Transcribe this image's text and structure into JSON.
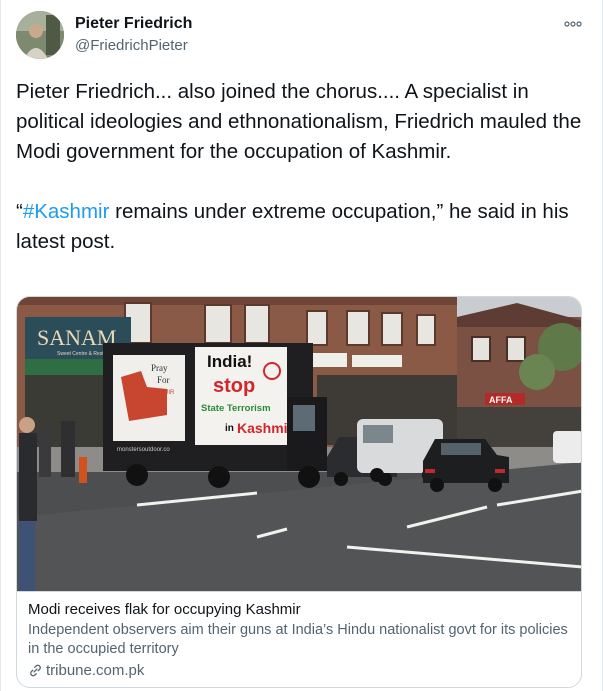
{
  "user": {
    "display_name": "Pieter Friedrich",
    "handle": "@FriedrichPieter"
  },
  "tweet": {
    "paragraph1": "Pieter Friedrich... also joined the chorus.... A specialist in political ideologies and ethnonationalism, Friedrich mauled the Modi government for the occupation of Kashmir.",
    "quote_open": "“",
    "hashtag": "#Kashmir",
    "paragraph2_rest": " remains under extreme occupation,” he said in his latest post."
  },
  "card": {
    "title": "Modi receives flak for occupying Kashmir",
    "description": "Independent observers aim their guns at India’s Hindu nationalist govt for its policies in the occupied territory",
    "domain": "tribune.com.pk",
    "image": {
      "shop_sign": "SANAM",
      "shop_subsign": "Sweet Centre & Restaurant",
      "panel_left_text": [
        "Pray",
        "For",
        "KASHMIR"
      ],
      "panel_right_text": [
        "India!",
        "stop",
        "State Terrorism",
        "in",
        "Kashmir"
      ],
      "van_footer": "monstersoutdoor.co",
      "shop_sign_right": "AFFA"
    }
  },
  "icons": {
    "more": "more-dots-icon",
    "link": "link-icon"
  },
  "colors": {
    "link_blue": "#1d9bf0",
    "secondary_text": "#536471",
    "border": "#cfd9de"
  }
}
